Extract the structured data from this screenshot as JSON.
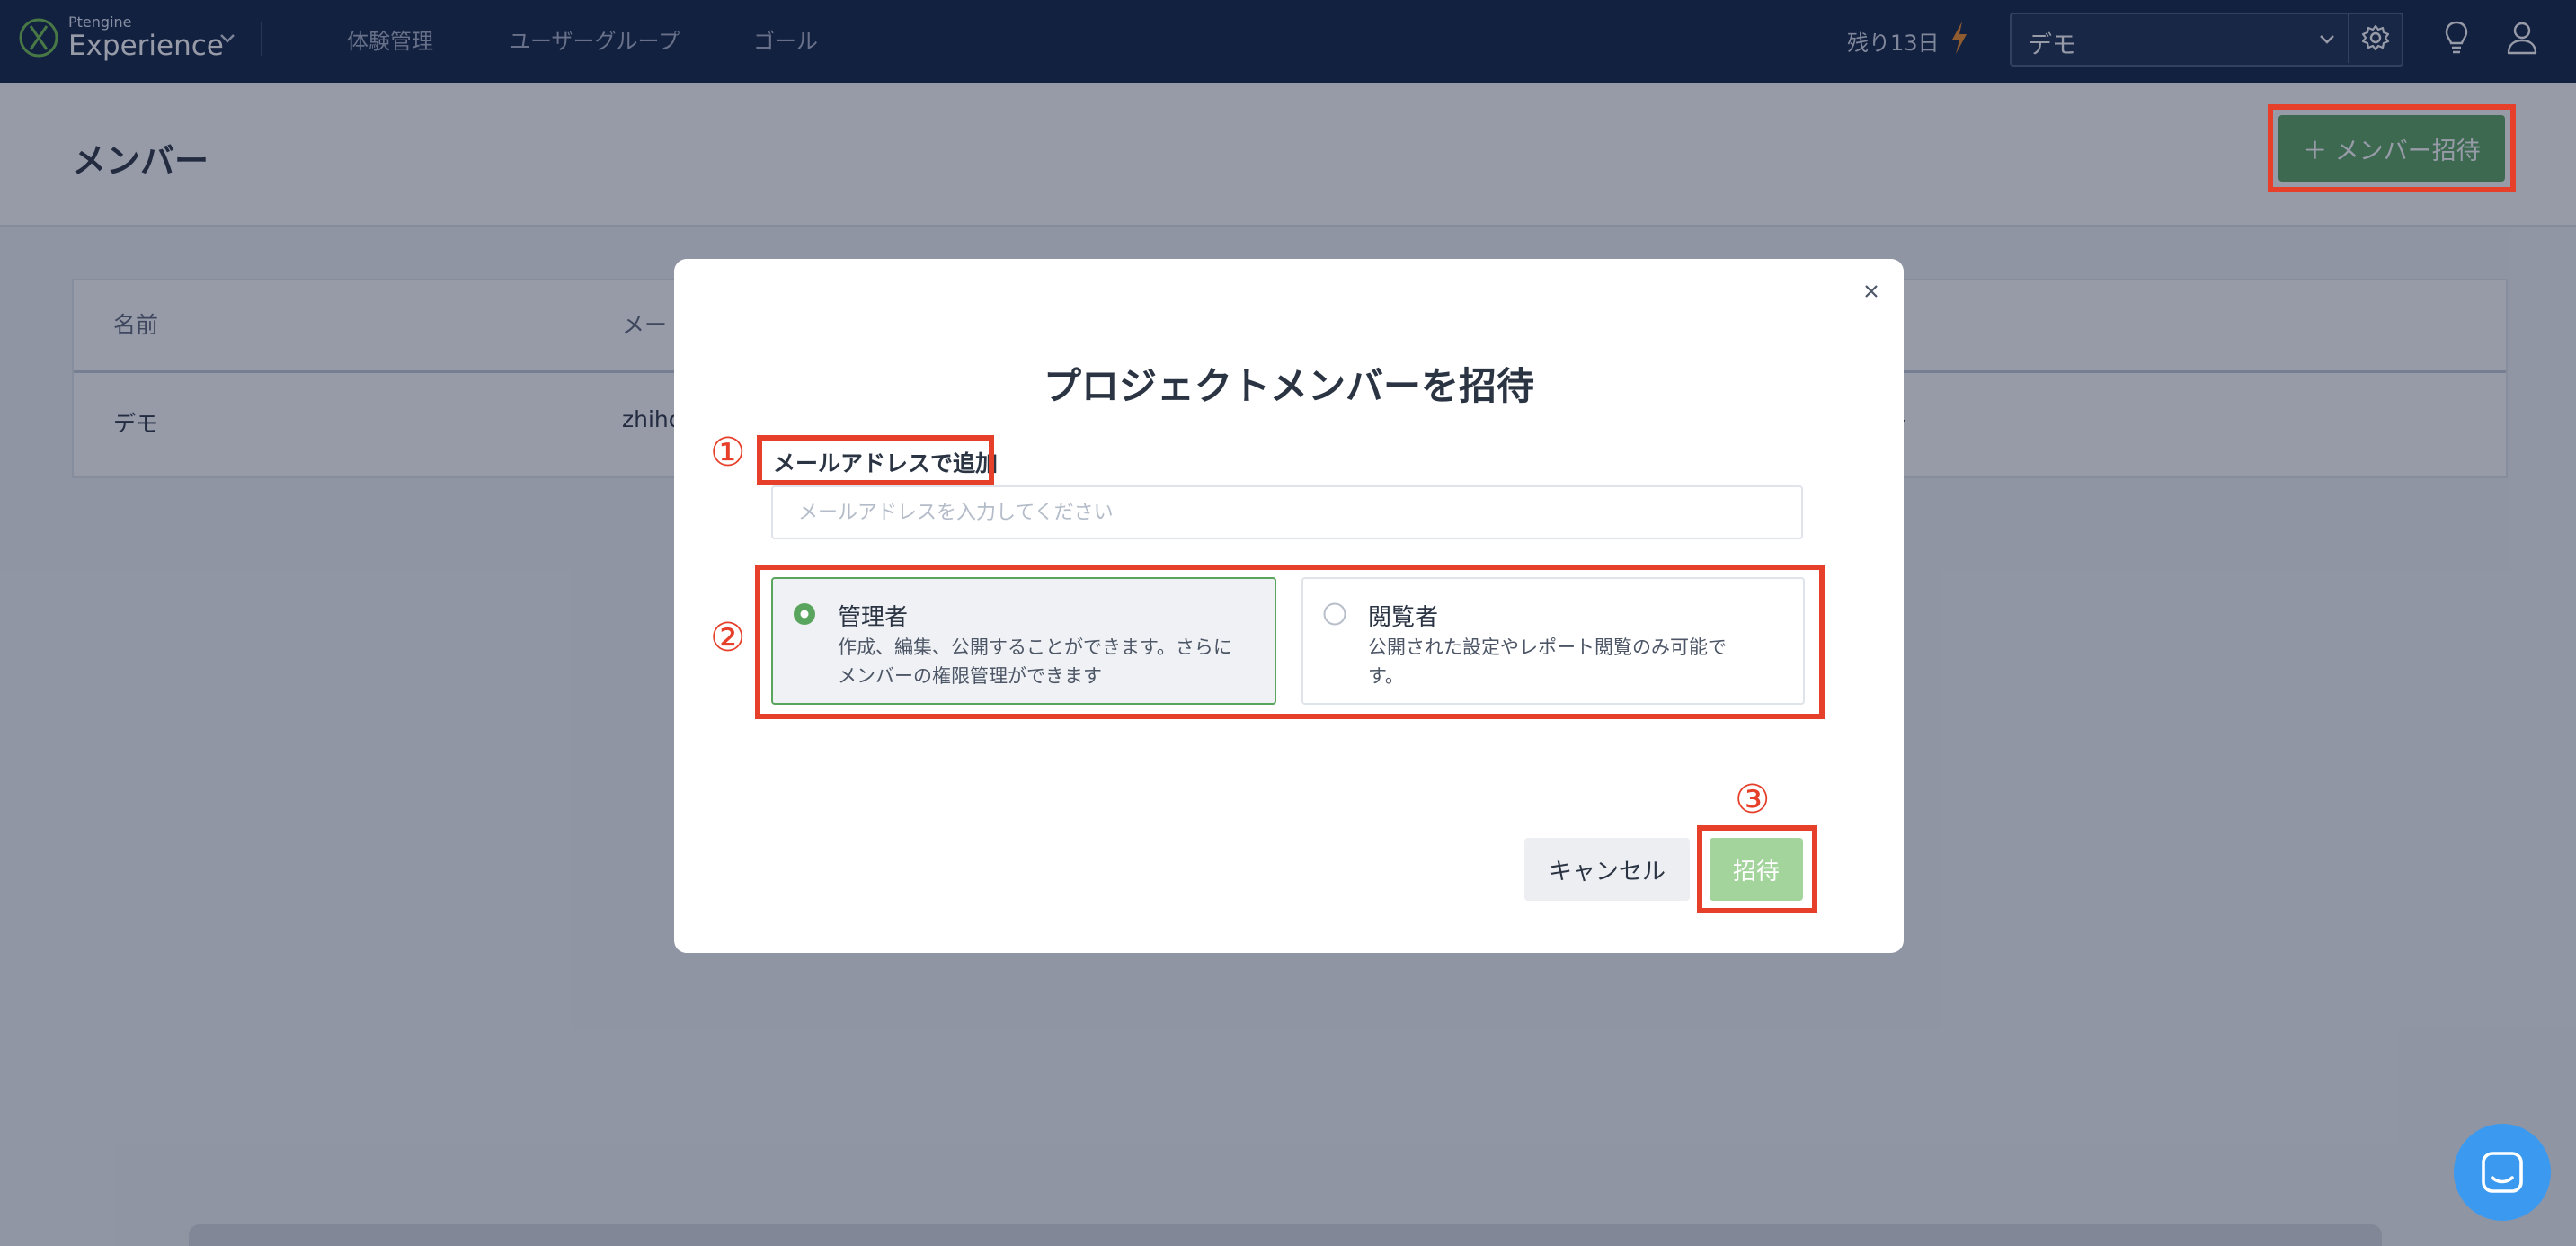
{
  "nav": {
    "logo_small": "Ptengine",
    "logo_big": "Experience",
    "links": [
      "体験管理",
      "ユーザーグループ",
      "ゴール"
    ],
    "trial": "残り13日",
    "project": "デモ",
    "icons": [
      "logo-mark-icon",
      "chevron-down-icon",
      "bolt-icon",
      "gear-icon",
      "lightbulb-icon",
      "user-icon"
    ]
  },
  "page": {
    "title": "メンバー",
    "invite_button": "＋  メンバー招待",
    "table": {
      "headers": [
        "名前",
        "メー"
      ],
      "row": {
        "name": "デモ",
        "email": "zhiho",
        "tail": "者"
      }
    }
  },
  "modal": {
    "title": "プロジェクトメンバーを招待",
    "email_label": "メールアドレスで追加",
    "email_placeholder": "メールアドレスを入力してください",
    "roles": [
      {
        "title": "管理者",
        "desc": "作成、編集、公開することができます。さらにメンバーの権限管理ができます",
        "selected": true
      },
      {
        "title": "閲覧者",
        "desc": "公開された設定やレポート閲覧のみ可能です。",
        "selected": false
      }
    ],
    "cancel": "キャンセル",
    "submit": "招待"
  },
  "annotations": {
    "color": "#e6402b",
    "step1": "①",
    "step2": "②",
    "step3": "③"
  },
  "colors": {
    "nav_bg": "#0f2142",
    "accent_green": "#5aa55d",
    "submit_disabled": "#a3d49c",
    "chat_blue": "#3b9af0"
  }
}
